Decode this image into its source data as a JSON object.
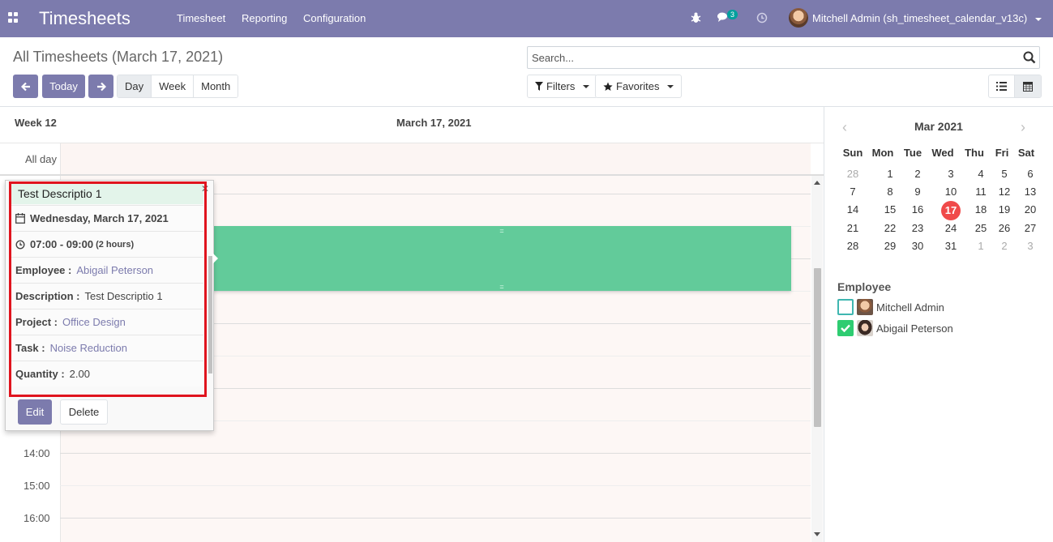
{
  "navbar": {
    "brand": "Timesheets",
    "menu": [
      "Timesheet",
      "Reporting",
      "Configuration"
    ],
    "message_count": "3",
    "user": "Mitchell Admin (sh_timesheet_calendar_v13c)"
  },
  "control_panel": {
    "title": "All Timesheets (March 17, 2021)",
    "today_label": "Today",
    "scales": [
      "Day",
      "Week",
      "Month"
    ],
    "active_scale": "Day",
    "search_placeholder": "Search...",
    "filters_label": "Filters",
    "favorites_label": "Favorites"
  },
  "calendar": {
    "week_label": "Week 12",
    "date_label": "March 17, 2021",
    "all_day_label": "All day",
    "times": [
      "14:00",
      "15:00",
      "16:00"
    ]
  },
  "popover": {
    "title": "Test Descriptio 1",
    "date": "Wednesday, March 17, 2021",
    "time": "07:00 - 09:00",
    "duration": "(2 hours)",
    "fields": [
      {
        "label": "Employee :",
        "value": "Abigail Peterson",
        "link": true
      },
      {
        "label": "Description :",
        "value": "Test Descriptio 1",
        "link": false
      },
      {
        "label": "Project :",
        "value": "Office Design",
        "link": true
      },
      {
        "label": "Task :",
        "value": "Noise Reduction",
        "link": true
      },
      {
        "label": "Quantity :",
        "value": "2.00",
        "link": false
      }
    ],
    "edit_label": "Edit",
    "delete_label": "Delete"
  },
  "mini_calendar": {
    "title": "Mar 2021",
    "weekdays": [
      "Sun",
      "Mon",
      "Tue",
      "Wed",
      "Thu",
      "Fri",
      "Sat"
    ],
    "weeks": [
      [
        "28",
        "1",
        "2",
        "3",
        "4",
        "5",
        "6"
      ],
      [
        "7",
        "8",
        "9",
        "10",
        "11",
        "12",
        "13"
      ],
      [
        "14",
        "15",
        "16",
        "17",
        "18",
        "19",
        "20"
      ],
      [
        "21",
        "22",
        "23",
        "24",
        "25",
        "26",
        "27"
      ],
      [
        "28",
        "29",
        "30",
        "31",
        "1",
        "2",
        "3"
      ]
    ],
    "today": "17"
  },
  "employees": {
    "title": "Employee",
    "items": [
      {
        "name": "Mitchell Admin",
        "checked": false
      },
      {
        "name": "Abigail Peterson",
        "checked": true
      }
    ]
  },
  "colors": {
    "brand": "#7c7bad",
    "event": "#62cb9a",
    "today": "#f04a4a",
    "highlight_box": "#e0141e"
  }
}
